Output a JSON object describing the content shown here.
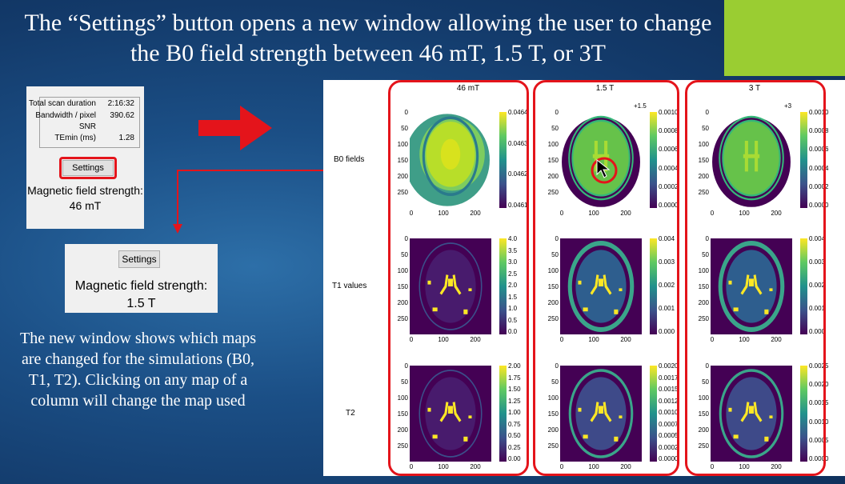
{
  "slide": {
    "title": "The “Settings” button opens a new window allowing the user to change the B0 field strength between 46 mT, 1.5 T, or 3T",
    "description": "The new window shows which maps are changed for the simulations (B0, T1, T2). Clicking on any map of a column will change the map used"
  },
  "panel_a": {
    "stats": [
      {
        "label": "Total scan duration",
        "value": "2:16:32"
      },
      {
        "label": "Bandwidth / pixel",
        "value": "390.62"
      },
      {
        "label": "SNR",
        "value": ""
      },
      {
        "label": "TEmin (ms)",
        "value": "1.28"
      }
    ],
    "settings_label": "Settings",
    "field_label": "Magnetic field strength:",
    "field_value": "46 mT"
  },
  "panel_b": {
    "settings_label": "Settings",
    "field_label": "Magnetic field strength:",
    "field_value": "1.5 T"
  },
  "figure": {
    "columns": [
      "46 mT",
      "1.5 T",
      "3 T"
    ],
    "rows": [
      "B0 fields",
      "T1 values",
      "T2"
    ],
    "y_ticks": [
      "0",
      "50",
      "100",
      "150",
      "200",
      "250"
    ],
    "x_ticks": [
      "0",
      "100",
      "200"
    ],
    "offsets": [
      "",
      "+1.5",
      "+3"
    ],
    "colorbars": [
      [
        [
          "0.0464",
          "0.0463",
          "0.0462",
          "0.0461"
        ],
        [
          "0.0010",
          "0.0008",
          "0.0006",
          "0.0004",
          "0.0002",
          "0.0000"
        ],
        [
          "0.0010",
          "0.0008",
          "0.0006",
          "0.0004",
          "0.0002",
          "0.0000"
        ]
      ],
      [
        [
          "4.0",
          "3.5",
          "3.0",
          "2.5",
          "2.0",
          "1.5",
          "1.0",
          "0.5",
          "0.0"
        ],
        [
          "0.004",
          "0.003",
          "0.002",
          "0.001",
          "0.000"
        ],
        [
          "0.004",
          "0.003",
          "0.002",
          "0.001",
          "0.000"
        ]
      ],
      [
        [
          "2.00",
          "1.75",
          "1.50",
          "1.25",
          "1.00",
          "0.75",
          "0.50",
          "0.25",
          "0.00"
        ],
        [
          "0.0020",
          "0.0017",
          "0.0015",
          "0.0012",
          "0.0010",
          "0.0007",
          "0.0005",
          "0.0002",
          "0.0000"
        ],
        [
          "0.0025",
          "0.0020",
          "0.0015",
          "0.0010",
          "0.0005",
          "0.0000"
        ]
      ]
    ]
  },
  "colors": {
    "accent": "#e4141b",
    "green_bar": "#9acd32",
    "viridis_dark": "#440154",
    "viridis_yellow": "#fde725"
  }
}
